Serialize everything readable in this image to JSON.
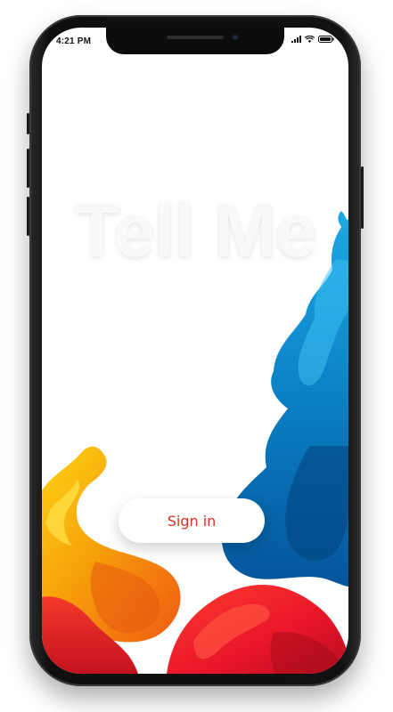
{
  "status_bar": {
    "time": "4:21 PM",
    "icons": [
      "signal-icon",
      "wifi-icon",
      "battery-icon"
    ]
  },
  "app": {
    "title": "Tell Me",
    "sign_in_label": "Sign in"
  },
  "colors": {
    "accent_text": "#d9321f",
    "ink_blue": "#0a7fc4",
    "ink_red": "#e8162a",
    "ink_orange": "#f47a0c",
    "ink_yellow": "#f9c10a"
  }
}
